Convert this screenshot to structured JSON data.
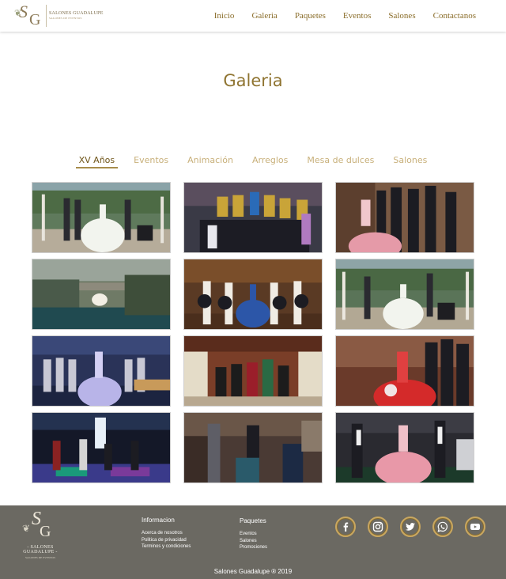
{
  "brand": {
    "monogram_s": "S",
    "monogram_g": "G",
    "name": "SALONES GUADALUPE",
    "tagline": "SALONES DE EVENTOS"
  },
  "nav": {
    "items": [
      "Inicio",
      "Galeria",
      "Paquetes",
      "Eventos",
      "Salones",
      "Contactanos"
    ]
  },
  "page": {
    "title": "Galeria"
  },
  "tabs": {
    "items": [
      "XV Años",
      "Eventos",
      "Animación",
      "Arreglos",
      "Mesa de dulces",
      "Salones"
    ],
    "active": "XV Años"
  },
  "gallery": {
    "photo_count": 12
  },
  "footer": {
    "logo_name": "- SALONES GUADALUPE -",
    "logo_tagline": "SALONES DE EVENTOS",
    "info": {
      "heading": "Informacion",
      "links": [
        "Acerca de nosotros",
        "Politica de privacidad",
        "Terminos y condiciones"
      ]
    },
    "packages": {
      "heading": "Paquetes",
      "links": [
        "Eventos",
        "Salones",
        "Promociones"
      ]
    },
    "social": [
      "facebook-icon",
      "instagram-icon",
      "twitter-icon",
      "whatsapp-icon",
      "youtube-icon"
    ],
    "copyright": "Salones Guadalupe ® 2019"
  },
  "colors": {
    "gold": "#8f7431",
    "tab_inactive": "#c8b07a",
    "footer_bg": "#6b6962",
    "icon_ring": "#c9a760"
  }
}
